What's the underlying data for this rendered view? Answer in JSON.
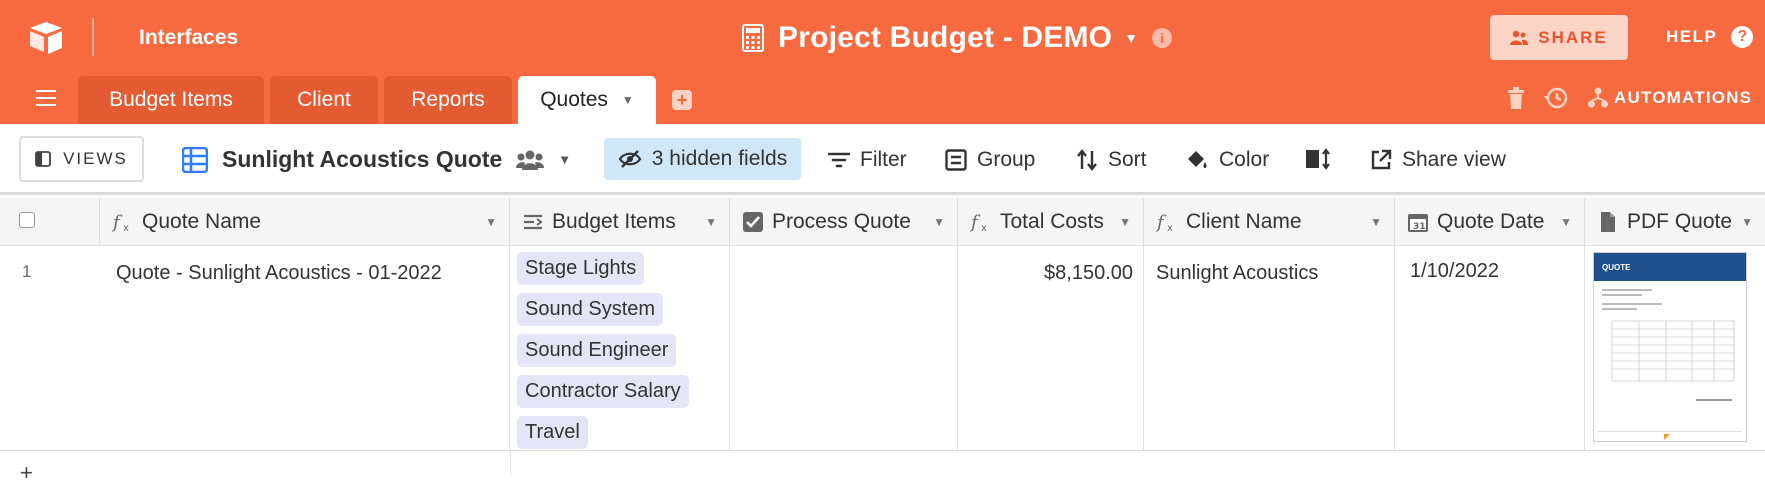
{
  "header": {
    "interfaces_label": "Interfaces",
    "base_title": "Project Budget - DEMO",
    "share_label": "SHARE",
    "help_label": "HELP",
    "automations_label": "AUTOMATIONS",
    "accent_color": "#f7693e"
  },
  "tabs": [
    {
      "label": "Budget Items",
      "active": false
    },
    {
      "label": "Client",
      "active": false
    },
    {
      "label": "Reports",
      "active": false
    },
    {
      "label": "Quotes",
      "active": true
    }
  ],
  "viewbar": {
    "views_label": "VIEWS",
    "view_name": "Sunlight Acoustics Quote",
    "hidden_fields_label": "3 hidden fields",
    "filter_label": "Filter",
    "group_label": "Group",
    "sort_label": "Sort",
    "color_label": "Color",
    "share_view_label": "Share view"
  },
  "grid": {
    "columns": [
      {
        "label": "Quote Name",
        "icon": "formula-icon"
      },
      {
        "label": "Budget Items",
        "icon": "linked-records-icon"
      },
      {
        "label": "Process Quote",
        "icon": "checkbox-icon"
      },
      {
        "label": "Total Costs",
        "icon": "formula-icon"
      },
      {
        "label": "Client Name",
        "icon": "formula-icon"
      },
      {
        "label": "Quote Date",
        "icon": "calendar-icon"
      },
      {
        "label": "PDF Quote",
        "icon": "attachment-icon"
      }
    ],
    "rows": [
      {
        "number": "1",
        "quote_name": "Quote - Sunlight Acoustics - 01-2022",
        "budget_items": [
          "Stage Lights",
          "Sound System",
          "Sound Engineer",
          "Contractor Salary",
          "Travel"
        ],
        "process_quote": "",
        "total_costs": "$8,150.00",
        "client_name": "Sunlight Acoustics",
        "quote_date": "1/10/2022",
        "pdf_thumb_title": "QUOTE"
      }
    ],
    "add_row_label": "+"
  }
}
